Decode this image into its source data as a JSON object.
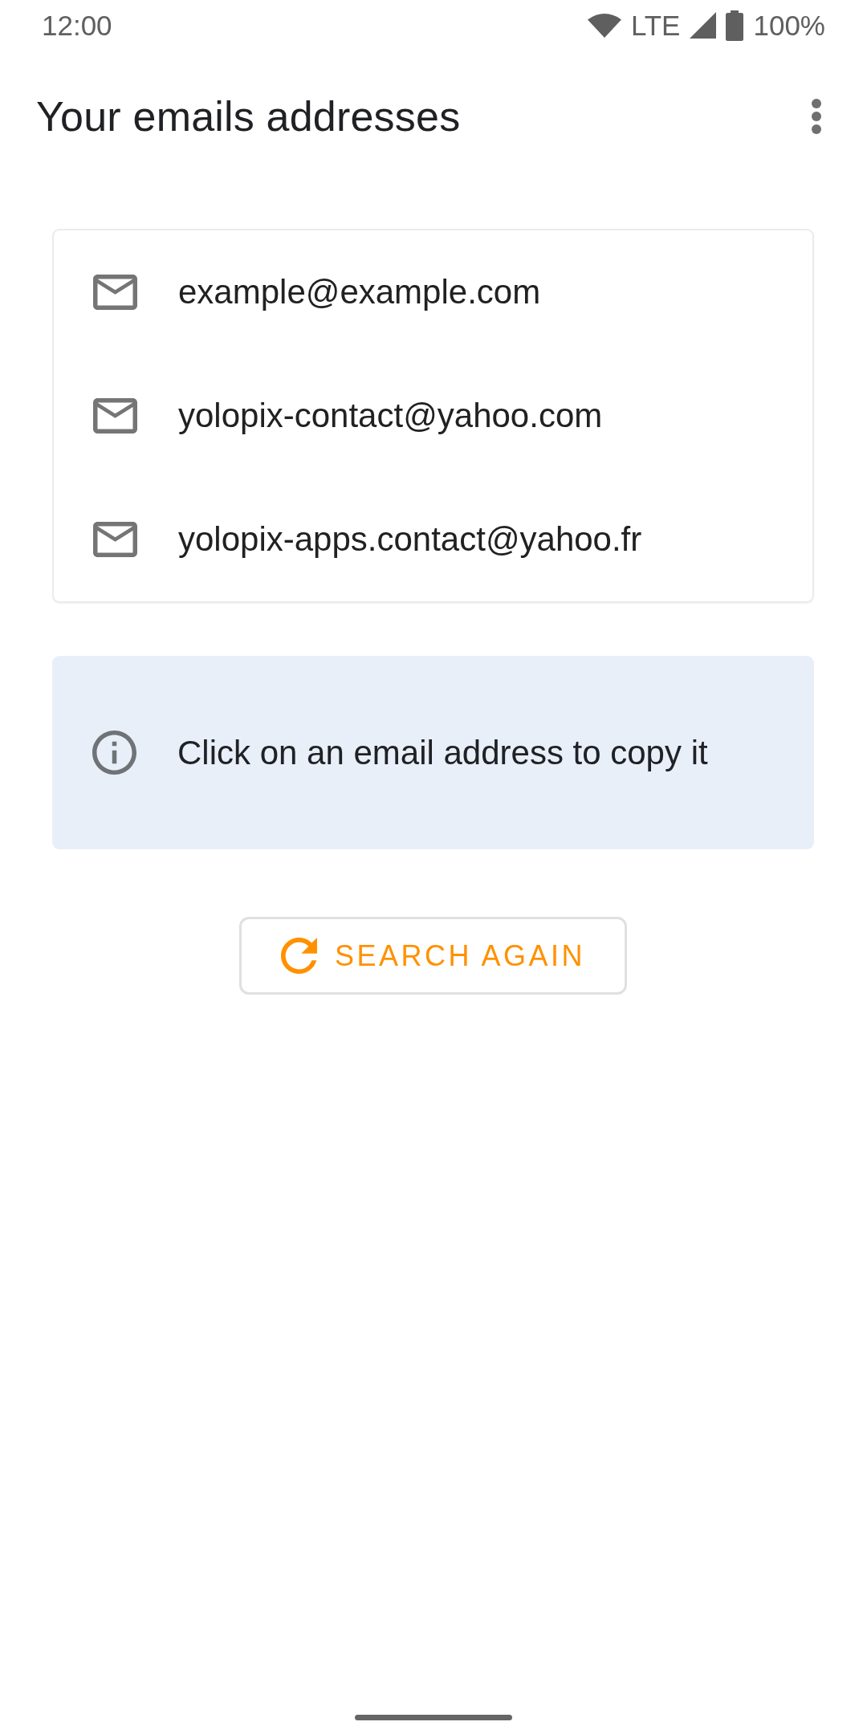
{
  "status_bar": {
    "time": "12:00",
    "network": "LTE",
    "battery": "100%"
  },
  "app_bar": {
    "title": "Your emails addresses"
  },
  "emails": [
    {
      "address": "example@example.com"
    },
    {
      "address": "yolopix-contact@yahoo.com"
    },
    {
      "address": "yolopix-apps.contact@yahoo.fr"
    }
  ],
  "info": {
    "text": "Click on an email address to copy it"
  },
  "button": {
    "label": "SEARCH AGAIN"
  }
}
